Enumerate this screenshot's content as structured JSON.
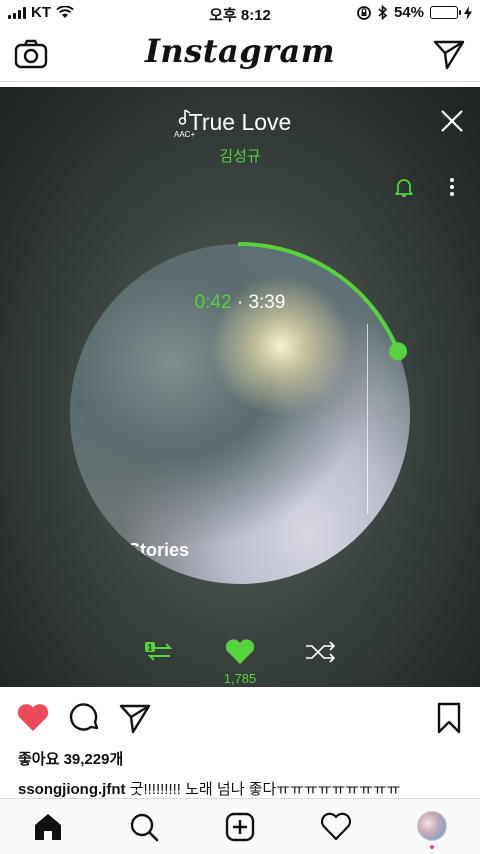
{
  "status_bar": {
    "carrier": "KT",
    "time": "오후 8:12",
    "battery_percent": "54%",
    "battery_level": 0.54
  },
  "header": {
    "logo": "Instagram",
    "camera_icon": "camera-icon",
    "direct_icon": "paper-plane-icon"
  },
  "player": {
    "codec_badge": "AAC+",
    "song_title": "True Love",
    "artist": "김성규",
    "elapsed": "0:42",
    "separator": "·",
    "duration": "3:39",
    "progress": 0.19,
    "cover_text": "Stories",
    "like_count": "1,785",
    "repeat_badge": "1",
    "accent_color": "#56d23c"
  },
  "post": {
    "likes": "좋아요 39,229개",
    "username": "ssongjiong.jfnt",
    "caption": "굿!!!!!!!!! 노래 넘나 좋다ㅠㅠㅠㅠㅠㅠㅠㅠㅠ"
  },
  "colors": {
    "like_red": "#ed4956",
    "text_dark": "#111111"
  }
}
